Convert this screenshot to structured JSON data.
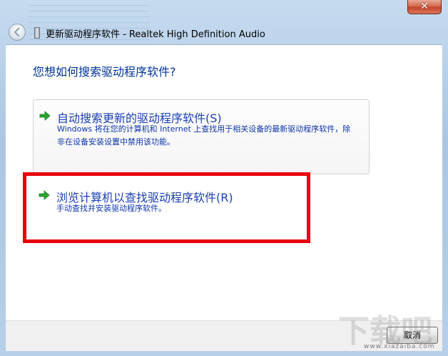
{
  "window": {
    "title": "更新驱动程序软件 - Realtek High Definition Audio",
    "close_glyph": "✕"
  },
  "main": {
    "question": "您想如何搜索驱动程序软件?",
    "options": [
      {
        "title": "自动搜索更新的驱动程序软件(S)",
        "description": "Windows 将在您的计算机和 Internet 上查找用于相关设备的最新驱动程序软件，除非在设备安装设置中禁用该功能。"
      },
      {
        "title": "浏览计算机以查找驱动程序软件(R)",
        "description": "手动查找并安装驱动程序软件。"
      }
    ]
  },
  "footer": {
    "cancel_label": "取消"
  },
  "watermark": {
    "text": "下载吧",
    "url": "www.xiazaiba.com"
  },
  "colors": {
    "link_blue": "#1a3fb6",
    "heading_blue": "#003399",
    "annotation_red": "#e8000b",
    "arrow_green": "#2aa52e"
  },
  "icons": {
    "back": "back-arrow-icon",
    "option_arrow": "green-arrow-icon",
    "device": "device-icon"
  }
}
